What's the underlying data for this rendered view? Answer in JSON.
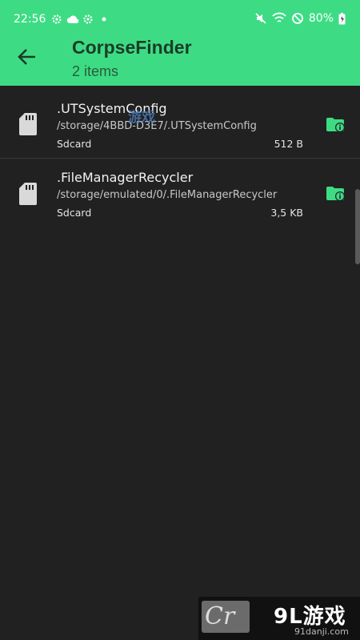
{
  "status_bar": {
    "time": "22:56",
    "battery_percent": "80%",
    "icons": [
      "gear-icon",
      "cloud-icon",
      "settings-icon",
      "dot-icon",
      "mute-icon",
      "wifi-icon",
      "dnd-icon",
      "battery-icon"
    ]
  },
  "header": {
    "title": "CorpseFinder",
    "subtitle": "2 items",
    "color": "#3ddc84"
  },
  "items": [
    {
      "name": ".UTSystemConfig",
      "path": "/storage/4BBD-D3E7/.UTSystemConfig",
      "location": "Sdcard",
      "size": "512 B"
    },
    {
      "name": ".FileManagerRecycler",
      "path": "/storage/emulated/0/.FileManagerRecycler",
      "location": "Sdcard",
      "size": "3,5 KB"
    }
  ],
  "watermark": {
    "logo_text": "Cr",
    "brand": "9L游戏",
    "url": "91danji.com",
    "overlay": "游戏"
  }
}
